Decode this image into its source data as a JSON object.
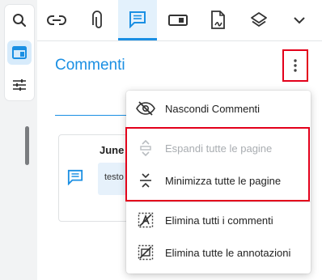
{
  "left_rail": {
    "items": [
      {
        "icon": "search-icon"
      },
      {
        "icon": "sidebar-panel-icon",
        "active": true
      },
      {
        "icon": "sliders-icon"
      }
    ]
  },
  "toolbar": {
    "tools": [
      {
        "icon": "link-icon"
      },
      {
        "icon": "paperclip-icon"
      },
      {
        "icon": "comment-icon",
        "active": true
      },
      {
        "icon": "form-field-icon"
      },
      {
        "icon": "signature-file-icon"
      },
      {
        "icon": "layers-icon"
      },
      {
        "icon": "chevron-down-icon"
      }
    ]
  },
  "panel": {
    "title": "Commenti"
  },
  "comment": {
    "date": "June",
    "text": "testo"
  },
  "menu": {
    "items": [
      {
        "label": "Nascondi Commenti",
        "icon": "eye-slash-icon",
        "disabled": false
      },
      {
        "label": "Espandi tutte le pagine",
        "icon": "expand-pages-icon",
        "disabled": true
      },
      {
        "label": "Minimizza tutte le pagine",
        "icon": "collapse-pages-icon",
        "disabled": false
      },
      {
        "label": "Elimina tutti i commenti",
        "icon": "delete-comments-icon",
        "disabled": false
      },
      {
        "label": "Elimina tutte le annotazioni",
        "icon": "delete-annotations-icon",
        "disabled": false
      }
    ]
  },
  "colors": {
    "accent": "#1a8fe3",
    "highlight": "#e3001b",
    "disabled_text": "#a9adb1"
  }
}
